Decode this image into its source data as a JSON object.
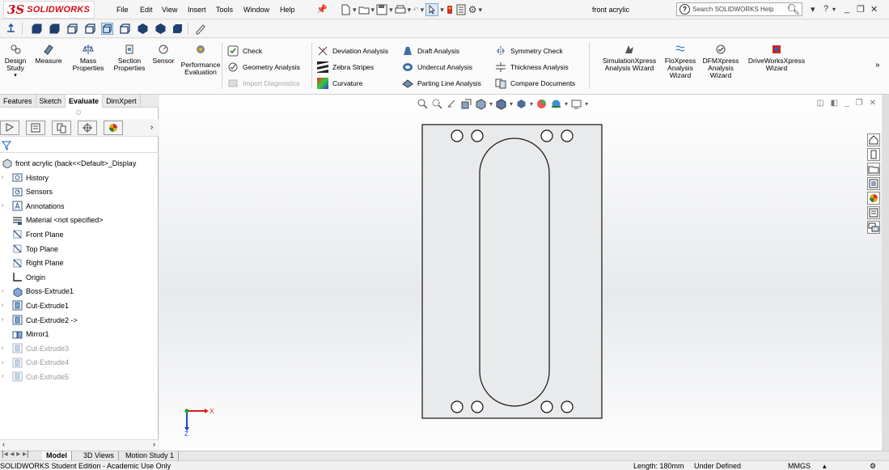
{
  "app": {
    "logo_ds": "3S",
    "logo_text": "SOLIDWORKS",
    "menu": [
      "File",
      "Edit",
      "View",
      "Insert",
      "Tools",
      "Window",
      "Help"
    ],
    "document_title": "front acrylic",
    "help_search_placeholder": "Search SOLIDWORKS Help"
  },
  "ribbon": {
    "design_study": "Design Study",
    "measure": "Measure",
    "mass_properties": "Mass Properties",
    "section_properties": "Section Properties",
    "sensor": "Sensor",
    "performance_evaluation": "Performance Evaluation",
    "check": "Check",
    "geometry_analysis": "Geometry Analysis",
    "import_diagnostics": "Import Diagnostics",
    "deviation_analysis": "Deviation Analysis",
    "zebra_stripes": "Zebra Stripes",
    "curvature": "Curvature",
    "draft_analysis": "Draft Analysis",
    "undercut_analysis": "Undercut Analysis",
    "parting_line_analysis": "Parting Line Analysis",
    "symmetry_check": "Symmetry Check",
    "thickness_analysis": "Thickness Analysis",
    "compare_documents": "Compare Documents",
    "simulationxpress": "SimulationXpress Analysis Wizard",
    "floxpress": "FloXpress Analysis Wizard",
    "dfmxpress": "DFMXpress Analysis Wizard",
    "driveworksxpress": "DriveWorksXpress Wizard"
  },
  "command_tabs": [
    "Features",
    "Sketch",
    "Evaluate",
    "DimXpert"
  ],
  "active_command_tab": "Evaluate",
  "feature_tree": {
    "root": "front acrylic  (back<<Default>_Display",
    "items": [
      {
        "label": "History",
        "icon": "history-icon",
        "expandable": true
      },
      {
        "label": "Sensors",
        "icon": "sensors-icon",
        "expandable": false
      },
      {
        "label": "Annotations",
        "icon": "annotations-icon",
        "expandable": true
      },
      {
        "label": "Material <not specified>",
        "icon": "material-icon",
        "expandable": false
      },
      {
        "label": "Front Plane",
        "icon": "plane-icon",
        "expandable": false
      },
      {
        "label": "Top Plane",
        "icon": "plane-icon",
        "expandable": false
      },
      {
        "label": "Right Plane",
        "icon": "plane-icon",
        "expandable": false
      },
      {
        "label": "Origin",
        "icon": "origin-icon",
        "expandable": false
      },
      {
        "label": "Boss-Extrude1",
        "icon": "boss-extrude-icon",
        "expandable": true
      },
      {
        "label": "Cut-Extrude1",
        "icon": "cut-extrude-icon",
        "expandable": true
      },
      {
        "label": "Cut-Extrude2 ->",
        "icon": "cut-extrude-icon",
        "expandable": true
      },
      {
        "label": "Mirror1",
        "icon": "mirror-icon",
        "expandable": false
      },
      {
        "label": "Cut-Extrude3",
        "icon": "cut-extrude-icon",
        "expandable": true,
        "suppressed": true
      },
      {
        "label": "Cut-Extrude4",
        "icon": "cut-extrude-icon",
        "expandable": true,
        "suppressed": true
      },
      {
        "label": "Cut-Extrude5",
        "icon": "cut-extrude-icon",
        "expandable": true,
        "suppressed": true
      }
    ]
  },
  "bottom_tabs": [
    "Model",
    "3D Views",
    "Motion Study 1"
  ],
  "status": {
    "left": "SOLIDWORKS Student Edition - Academic Use Only",
    "length": "Length: 180mm",
    "state": "Under Defined",
    "units": "MMGS"
  },
  "triad": {
    "x_label": "X",
    "z_label": "Z"
  },
  "colors": {
    "brand_red": "#d40f14",
    "triad_x": "#d42020",
    "triad_y": "#1aa31a",
    "triad_z": "#2346c8"
  }
}
